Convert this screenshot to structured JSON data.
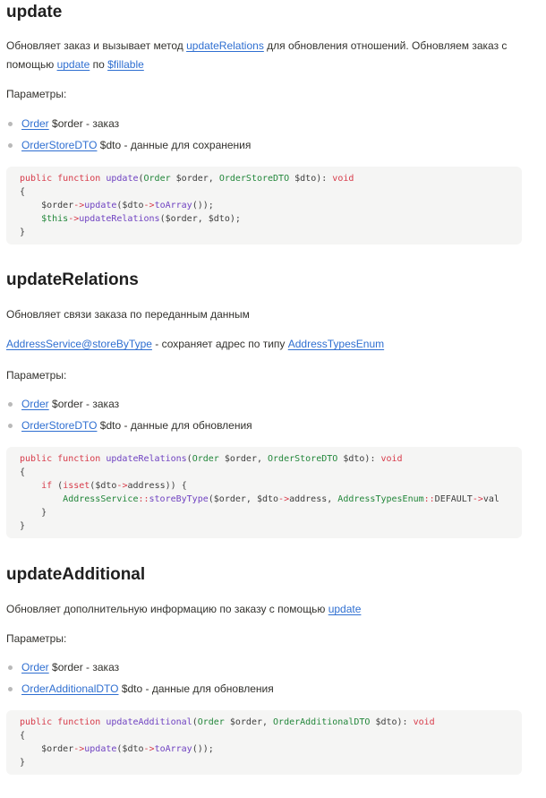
{
  "sections": [
    {
      "title": "update",
      "desc": {
        "t1": "Обновляет заказ и вызывает метод ",
        "l1": "updateRelations",
        "t2": " для обновления отношений. Обновляем заказ с помощью ",
        "l2": "update",
        "t3": " по ",
        "l3": "$fillable"
      },
      "params_label": "Параметры:",
      "params": [
        {
          "link": "Order",
          "text": " $order - заказ"
        },
        {
          "link": "OrderStoreDTO",
          "text": " $dto - данные для сохранения"
        }
      ]
    },
    {
      "title": "updateRelations",
      "desc_text": "Обновляет связи заказа по переданным данным",
      "note": {
        "l1": "AddressService@storeByType",
        "t1": " - сохраняет адрес по типу ",
        "l2": "AddressTypesEnum"
      },
      "params_label": "Параметры:",
      "params": [
        {
          "link": "Order",
          "text": " $order - заказ"
        },
        {
          "link": "OrderStoreDTO",
          "text": " $dto - данные для обновления"
        }
      ]
    },
    {
      "title": "updateAdditional",
      "desc": {
        "t1": "Обновляет дополнительную информацию по заказу с помощью ",
        "l1": "update"
      },
      "params_label": "Параметры:",
      "params": [
        {
          "link": "Order",
          "text": " $order - заказ"
        },
        {
          "link": "OrderAdditionalDTO",
          "text": " $dto - данные для обновления"
        }
      ]
    }
  ],
  "code": {
    "kw_public": "public",
    "kw_function": "function",
    "kw_void": "void",
    "kw_if": "if",
    "kw_isset": "isset",
    "fn_update": "update",
    "fn_toArray": "toArray",
    "fn_updateRelations": "updateRelations",
    "fn_storeByType": "storeByType",
    "fn_updateAdditional": "updateAdditional",
    "ty_Order": "Order",
    "ty_OrderStoreDTO": "OrderStoreDTO",
    "ty_AddressService": "AddressService",
    "ty_AddressTypesEnum": "AddressTypesEnum",
    "ty_OrderAdditionalDTO": "OrderAdditionalDTO",
    "v_order": "$order",
    "v_dto": "$dto",
    "v_this": "$this",
    "arrow": "->",
    "dcolon": "::",
    "prop_address": "address",
    "const_default": "DEFAULT",
    "tail_val": "val",
    "lbrace": "{",
    "rbrace": "}"
  }
}
